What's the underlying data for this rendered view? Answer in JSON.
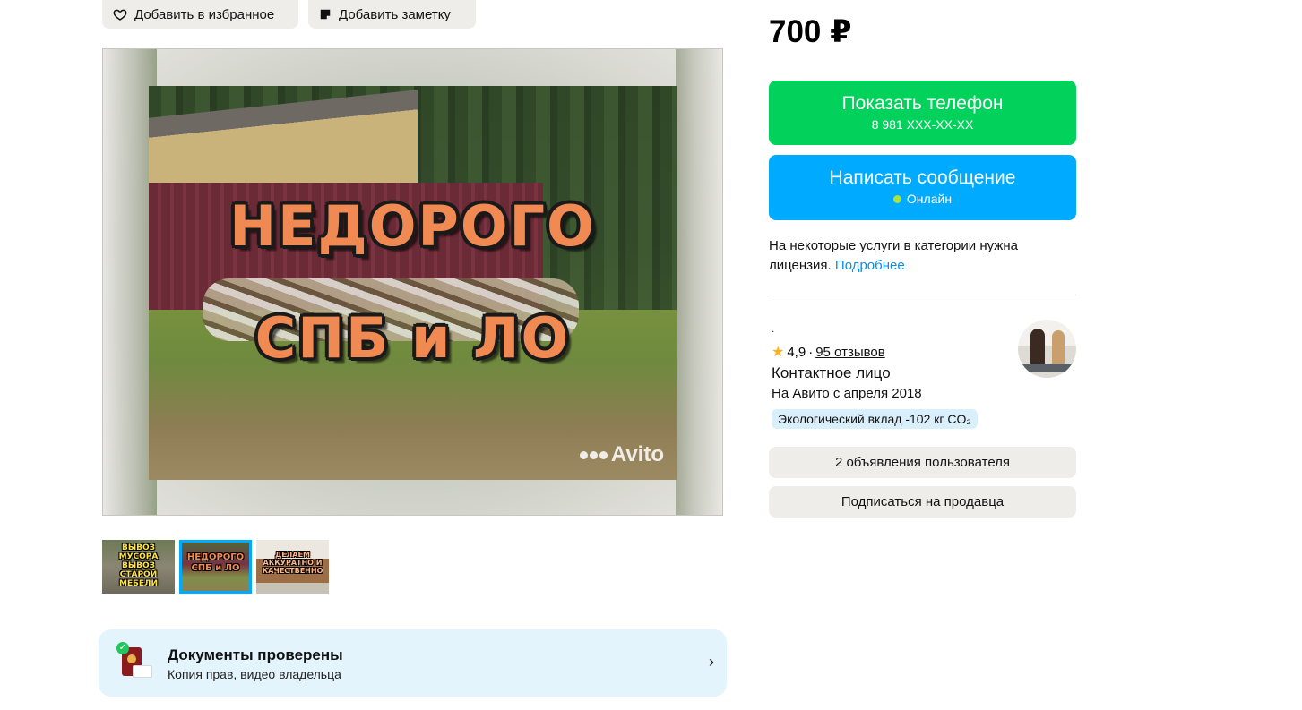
{
  "actions": {
    "favorite_label": "Добавить в избранное",
    "note_label": "Добавить заметку"
  },
  "gallery": {
    "main_overlay_line1": "НЕДОРОГО",
    "main_overlay_line2": "СПБ и ЛО",
    "watermark": "Avito",
    "thumbnails": [
      {
        "text": "ВЫВОЗ МУСОРА ВЫВОЗ СТАРОЙ МЕБЕЛИ",
        "selected": false
      },
      {
        "text": "НЕДОРОГО СПБ и ЛО",
        "selected": true
      },
      {
        "text": "ДЕЛАЕМ АККУРАТНО И КАЧЕСТВЕННО",
        "selected": false
      }
    ]
  },
  "documents": {
    "title": "Документы проверены",
    "subtitle": "Копия прав, видео владельца"
  },
  "price": "700 ₽",
  "contact": {
    "phone_label": "Показать телефон",
    "phone_masked": "8 981 XXX-XX-XX",
    "message_label": "Написать сообщение",
    "online_status": "Онлайн",
    "online_color": "#a8e33e"
  },
  "license": {
    "text": "На некоторые услуги в категории нужна лицензия.",
    "link": "Подробнее"
  },
  "seller": {
    "name_placeholder": ".",
    "rating": "4,9",
    "separator": "·",
    "reviews": "95 отзывов",
    "role": "Контактное лицо",
    "since": "На Авито с апреля 2018",
    "eco_badge": "Экологический вклад -102 кг CO₂"
  },
  "seller_actions": {
    "ads_label": "2 объявления пользователя",
    "subscribe_label": "Подписаться на продавца"
  },
  "colors": {
    "green_button": "#02d15c",
    "blue_button": "#00aaff",
    "link": "#0a8ee4",
    "star": "#ffb021"
  }
}
